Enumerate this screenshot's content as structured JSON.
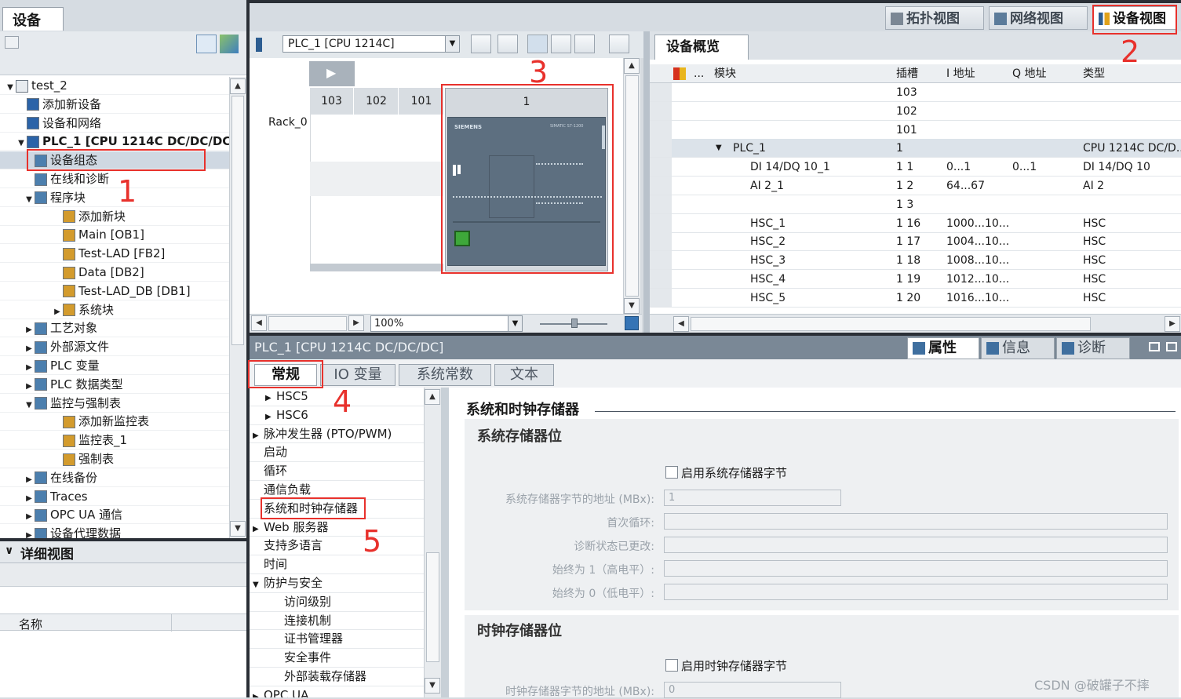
{
  "project_panel": {
    "tab": "设备",
    "tree": [
      {
        "label": "test_2",
        "level": 0,
        "expanded": true
      },
      {
        "label": "添加新设备",
        "level": 1
      },
      {
        "label": "设备和网络",
        "level": 1
      },
      {
        "label": "PLC_1 [CPU 1214C DC/DC/DC]",
        "level": 1,
        "expanded": true
      },
      {
        "label": "设备组态",
        "level": 2,
        "selected": true
      },
      {
        "label": "在线和诊断",
        "level": 2
      },
      {
        "label": "程序块",
        "level": 2,
        "expanded": true
      },
      {
        "label": "添加新块",
        "level": 3
      },
      {
        "label": "Main [OB1]",
        "level": 3
      },
      {
        "label": "Test-LAD [FB2]",
        "level": 3
      },
      {
        "label": "Data [DB2]",
        "level": 3
      },
      {
        "label": "Test-LAD_DB [DB1]",
        "level": 3
      },
      {
        "label": "系统块",
        "level": 3,
        "expanded": false
      },
      {
        "label": "工艺对象",
        "level": 2,
        "expanded": false
      },
      {
        "label": "外部源文件",
        "level": 2,
        "expanded": false
      },
      {
        "label": "PLC 变量",
        "level": 2,
        "expanded": false
      },
      {
        "label": "PLC 数据类型",
        "level": 2,
        "expanded": false
      },
      {
        "label": "监控与强制表",
        "level": 2,
        "expanded": true
      },
      {
        "label": "添加新监控表",
        "level": 3
      },
      {
        "label": "监控表_1",
        "level": 3
      },
      {
        "label": "强制表",
        "level": 3
      },
      {
        "label": "在线备份",
        "level": 2,
        "expanded": false
      },
      {
        "label": "Traces",
        "level": 2,
        "expanded": false
      },
      {
        "label": "OPC UA 通信",
        "level": 2,
        "expanded": false
      },
      {
        "label": "设备代理数据",
        "level": 2,
        "expanded": false
      }
    ]
  },
  "detail_view": {
    "title": "详细视图",
    "col_name": "名称"
  },
  "view_tabs": {
    "topology": "拓扑视图",
    "network": "网络视图",
    "device": "设备视图"
  },
  "device_view": {
    "device_select": "PLC_1 [CPU 1214C]",
    "rack_label": "Rack_0",
    "slots": [
      "103",
      "102",
      "101",
      "1"
    ],
    "zoom": "100%",
    "cpu_brand": "SIEMENS",
    "cpu_model": "SIMATIC S7-1200"
  },
  "overview": {
    "title": "设备概览",
    "columns": [
      "...",
      "模块",
      "插槽",
      "I 地址",
      "Q 地址",
      "类型"
    ],
    "rows": [
      {
        "module": "",
        "slot": "103",
        "i": "",
        "q": "",
        "type": ""
      },
      {
        "module": "",
        "slot": "102",
        "i": "",
        "q": "",
        "type": ""
      },
      {
        "module": "",
        "slot": "101",
        "i": "",
        "q": "",
        "type": ""
      },
      {
        "module": "PLC_1",
        "slot": "1",
        "i": "",
        "q": "",
        "type": "CPU 1214C DC/D..."
      },
      {
        "module": "DI 14/DQ 10_1",
        "slot": "1 1",
        "i": "0...1",
        "q": "0...1",
        "type": "DI 14/DQ 10"
      },
      {
        "module": "AI 2_1",
        "slot": "1 2",
        "i": "64...67",
        "q": "",
        "type": "AI 2"
      },
      {
        "module": "",
        "slot": "1 3",
        "i": "",
        "q": "",
        "type": ""
      },
      {
        "module": "HSC_1",
        "slot": "1 16",
        "i": "1000...10...",
        "q": "",
        "type": "HSC"
      },
      {
        "module": "HSC_2",
        "slot": "1 17",
        "i": "1004...10...",
        "q": "",
        "type": "HSC"
      },
      {
        "module": "HSC_3",
        "slot": "1 18",
        "i": "1008...10...",
        "q": "",
        "type": "HSC"
      },
      {
        "module": "HSC_4",
        "slot": "1 19",
        "i": "1012...10...",
        "q": "",
        "type": "HSC"
      },
      {
        "module": "HSC_5",
        "slot": "1 20",
        "i": "1016...10...",
        "q": "",
        "type": "HSC"
      }
    ]
  },
  "properties": {
    "title": "PLC_1 [CPU 1214C DC/DC/DC]",
    "side_tabs": {
      "props": "属性",
      "info": "信息",
      "diag": "诊断"
    },
    "tabs": [
      "常规",
      "IO 变量",
      "系统常数",
      "文本"
    ],
    "nav": [
      {
        "label": "HSC5",
        "indent": 1,
        "arrow": true
      },
      {
        "label": "HSC6",
        "indent": 1,
        "arrow": true
      },
      {
        "label": "脉冲发生器 (PTO/PWM)",
        "indent": 0,
        "arrow": true
      },
      {
        "label": "启动",
        "indent": 0
      },
      {
        "label": "循环",
        "indent": 0
      },
      {
        "label": "通信负载",
        "indent": 0
      },
      {
        "label": "系统和时钟存储器",
        "indent": 0,
        "selected": true
      },
      {
        "label": "Web 服务器",
        "indent": 0,
        "arrow": true
      },
      {
        "label": "支持多语言",
        "indent": 0
      },
      {
        "label": "时间",
        "indent": 0
      },
      {
        "label": "防护与安全",
        "indent": 0,
        "arrow": true,
        "expanded": true
      },
      {
        "label": "访问级别",
        "indent": 2
      },
      {
        "label": "连接机制",
        "indent": 2
      },
      {
        "label": "证书管理器",
        "indent": 2
      },
      {
        "label": "安全事件",
        "indent": 2
      },
      {
        "label": "外部装载存储器",
        "indent": 2
      },
      {
        "label": "OPC UA",
        "indent": 0,
        "arrow": true
      }
    ],
    "section_title": "系统和时钟存储器",
    "sys_group": "系统存储器位",
    "sys_enable": "启用系统存储器字节",
    "sys_fields": [
      {
        "label": "系统存储器字节的地址 (MBx):",
        "value": "1"
      },
      {
        "label": "首次循环:",
        "value": ""
      },
      {
        "label": "诊断状态已更改:",
        "value": ""
      },
      {
        "label": "始终为 1（高电平）:",
        "value": ""
      },
      {
        "label": "始终为 0（低电平）:",
        "value": ""
      }
    ],
    "clk_group": "时钟存储器位",
    "clk_enable": "启用时钟存储器字节",
    "clk_addr_label": "时钟存储器字节的地址 (MBx):",
    "clk_addr_value": "0"
  },
  "annotations": [
    "1",
    "2",
    "3",
    "4",
    "5"
  ],
  "watermark": "CSDN @破罐子不摔"
}
